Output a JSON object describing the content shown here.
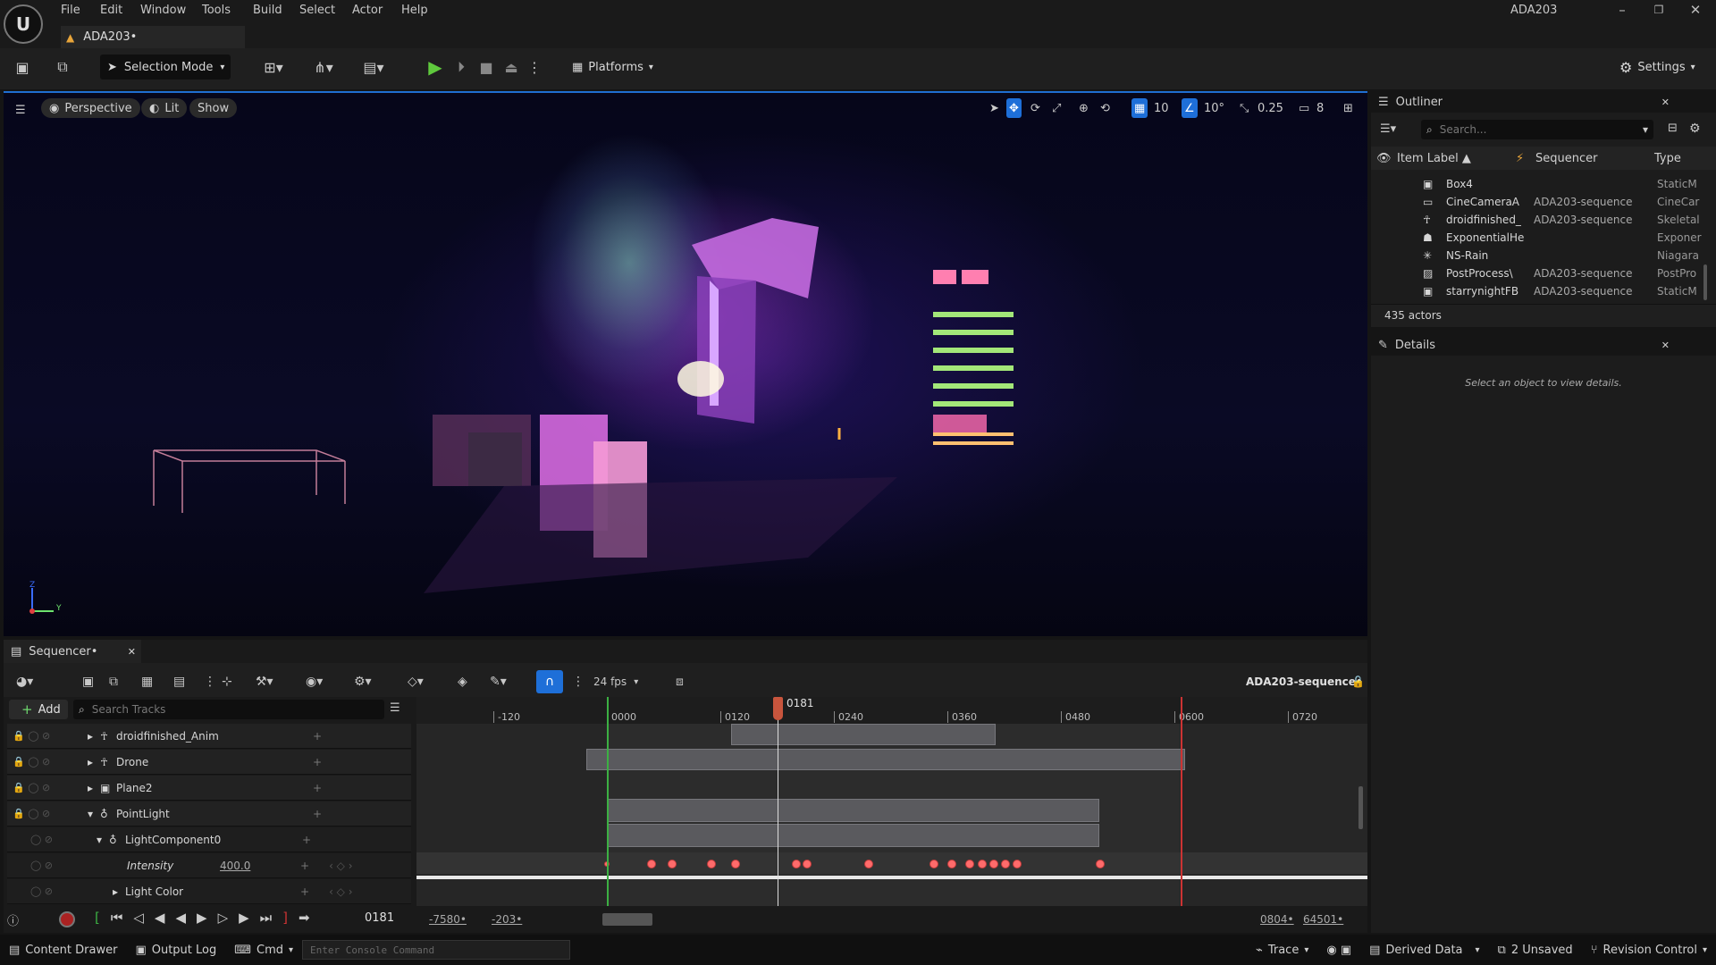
{
  "menu": [
    "File",
    "Edit",
    "Window",
    "Tools",
    "Build",
    "Select",
    "Actor",
    "Help"
  ],
  "app_title": "ADA203",
  "project_tab": "ADA203•",
  "toolbar": {
    "selection_mode": "Selection Mode",
    "platforms": "Platforms",
    "settings": "Settings"
  },
  "viewport": {
    "perspective": "Perspective",
    "lit": "Lit",
    "show": "Show",
    "grid_snap": "10",
    "rotation_snap": "10°",
    "scale_snap": "0.25",
    "camera_speed": "8",
    "axis_z": "Z",
    "axis_y": "Y"
  },
  "outliner": {
    "title": "Outliner",
    "search_placeholder": "Search...",
    "col_label": "Item Label ▲",
    "col_sequencer": "Sequencer",
    "col_type": "Type",
    "rows": [
      {
        "label": "Box4",
        "sequencer": "",
        "type": "StaticM"
      },
      {
        "label": "CineCameraA",
        "sequencer": "ADA203-sequence",
        "type": "CineCar"
      },
      {
        "label": "droidfinished_",
        "sequencer": "ADA203-sequence",
        "type": "Skeletal"
      },
      {
        "label": "ExponentialHe",
        "sequencer": "",
        "type": "Exponer"
      },
      {
        "label": "NS-Rain",
        "sequencer": "",
        "type": "Niagara"
      },
      {
        "label": "PostProcess\\",
        "sequencer": "ADA203-sequence",
        "type": "PostPro"
      },
      {
        "label": "starrynightFB",
        "sequencer": "ADA203-sequence",
        "type": "StaticM"
      }
    ],
    "count": "435 actors"
  },
  "details": {
    "title": "Details",
    "empty_text": "Select an object to view details."
  },
  "sequencer": {
    "tab": "Sequencer•",
    "fps": "24 fps",
    "sequence_name": "ADA203-sequence•",
    "add": "Add",
    "search_placeholder": "Search Tracks",
    "playhead": "0181",
    "ticks": [
      "-120",
      "0000",
      "0120",
      "0240",
      "0360",
      "0480",
      "0600",
      "0720"
    ],
    "tracks": [
      {
        "name": "droidfinished_Anim",
        "icon": "skeleton-icon"
      },
      {
        "name": "Drone",
        "icon": "skeleton-icon"
      },
      {
        "name": "Plane2",
        "icon": "cube-icon"
      },
      {
        "name": "PointLight",
        "icon": "bulb-icon"
      },
      {
        "name": "LightComponent0",
        "icon": "bulb-icon"
      },
      {
        "name": "Intensity",
        "value": "400.0"
      },
      {
        "name": "Light Color"
      }
    ],
    "current_frame": "0181",
    "range_start": "-7580•",
    "view_start": "-203•",
    "view_end": "0804•",
    "range_end": "64501•"
  },
  "status": {
    "content_drawer": "Content Drawer",
    "output_log": "Output Log",
    "cmd": "Cmd",
    "console_placeholder": "Enter Console Command",
    "trace": "Trace",
    "derived_data": "Derived Data",
    "unsaved": "2 Unsaved",
    "revision": "Revision Control"
  },
  "colors": {
    "accent": "#1e6fd8",
    "key": "#ff6b6b",
    "playhead": "#c8553d",
    "warn": "#e8a53a"
  }
}
